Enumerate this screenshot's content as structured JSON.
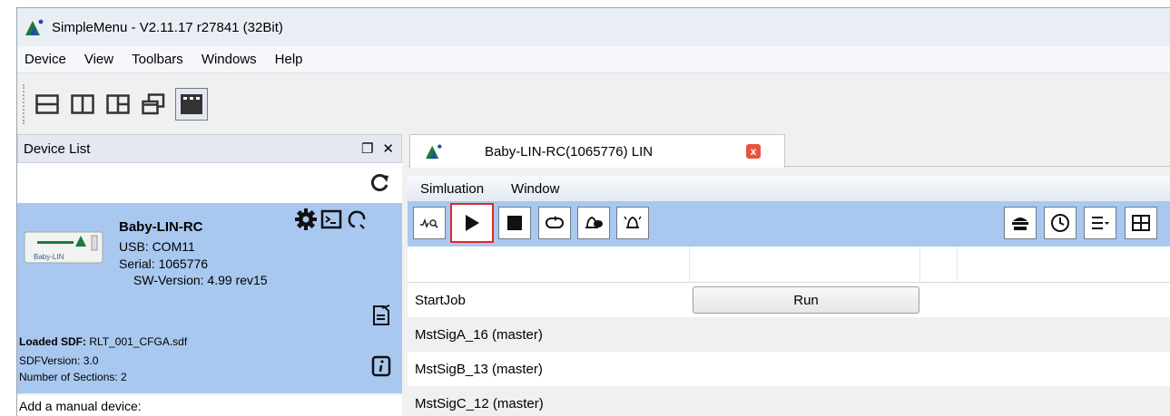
{
  "window": {
    "title": "SimpleMenu - V2.11.17 r27841 (32Bit)"
  },
  "menubar": {
    "items": [
      "Device",
      "View",
      "Toolbars",
      "Windows",
      "Help"
    ]
  },
  "toolbar": {
    "icons": [
      "split-horizontal-icon",
      "split-vertical-icon",
      "grid-icon",
      "cascade-icon",
      "tabs-icon"
    ]
  },
  "device_list": {
    "title": "Device List",
    "device": {
      "name": "Baby-LIN-RC",
      "usb": "USB: COM11",
      "serial": "Serial: 1065776",
      "sw_version": "SW-Version: 4.99 rev15"
    },
    "sdf": {
      "loaded_label": "Loaded SDF:",
      "loaded_file": "RLT_001_CFGA.sdf",
      "version": "SDFVersion: 3.0",
      "sections": "Number of Sections: 2"
    },
    "manual_device": "Add a manual device:",
    "device_image_text": "Baby-LIN"
  },
  "tab": {
    "label": "Baby-LIN-RC(1065776) LIN",
    "close": "x"
  },
  "sim_menu": {
    "items": [
      "Simluation",
      "Window"
    ]
  },
  "sim_toolbar": {
    "left": [
      "lin-monitor-icon",
      "play-icon",
      "stop-icon",
      "loop-icon",
      "bell-message-icon",
      "bell-alarm-icon"
    ],
    "right": [
      "bus-icon",
      "clock-icon",
      "list-menu-icon",
      "table-icon"
    ]
  },
  "grid": {
    "rows": [
      {
        "label": "StartJob",
        "button": "Run"
      },
      {
        "label": "MstSigA_16 (master)"
      },
      {
        "label": "MstSigB_13 (master)"
      },
      {
        "label": "MstSigC_12 (master)"
      }
    ]
  },
  "colors": {
    "panel_blue": "#a9c8f0",
    "highlight_red": "#e1282b",
    "close_red": "#e9523e"
  }
}
